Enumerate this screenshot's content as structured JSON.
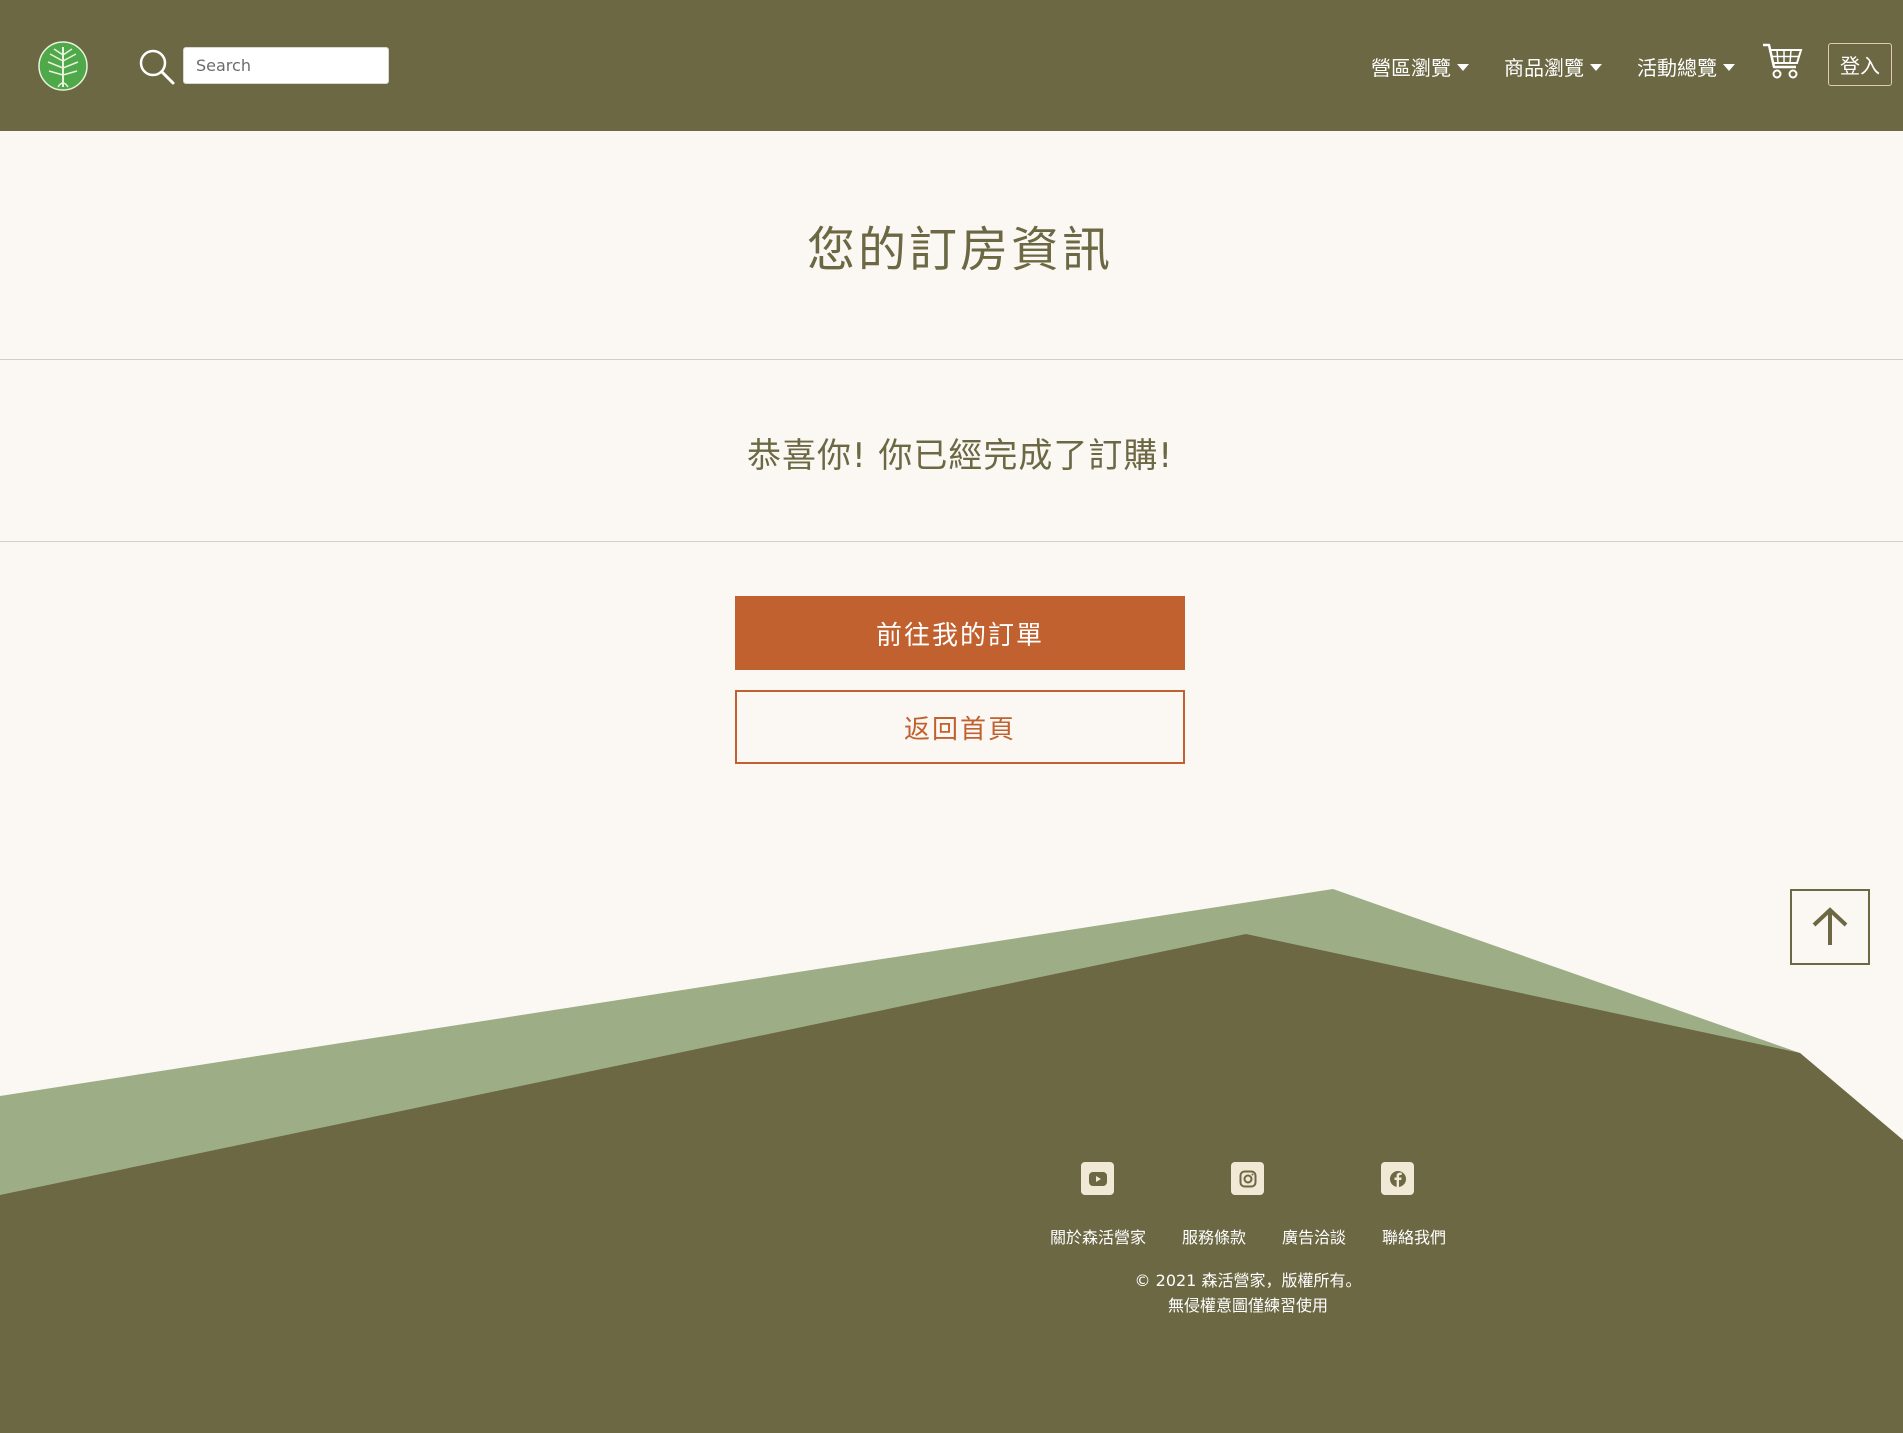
{
  "header": {
    "search": {
      "placeholder": "Search"
    },
    "nav": [
      {
        "label": "營區瀏覽"
      },
      {
        "label": "商品瀏覽"
      },
      {
        "label": "活動總覽"
      }
    ],
    "login_label": "登入"
  },
  "main": {
    "title": "您的訂房資訊",
    "success_message": "恭喜你! 你已經完成了訂購!",
    "orders_button": "前往我的訂單",
    "home_button": "返回首頁"
  },
  "footer": {
    "social_icons": [
      "youtube-icon",
      "instagram-icon",
      "facebook-icon"
    ],
    "links": [
      {
        "label": "關於森活營家"
      },
      {
        "label": "服務條款"
      },
      {
        "label": "廣告洽談"
      },
      {
        "label": "聯絡我們"
      }
    ],
    "copyright_line1": "© 2021 森活營家，版權所有。",
    "copyright_line2": "無侵權意圖僅練習使用"
  },
  "colors": {
    "primary_olive": "#6b6843",
    "light_sage": "#9dae86",
    "accent_orange": "#c26130",
    "background": "#fbf8f3",
    "icon_bg": "#f2e8d6"
  }
}
